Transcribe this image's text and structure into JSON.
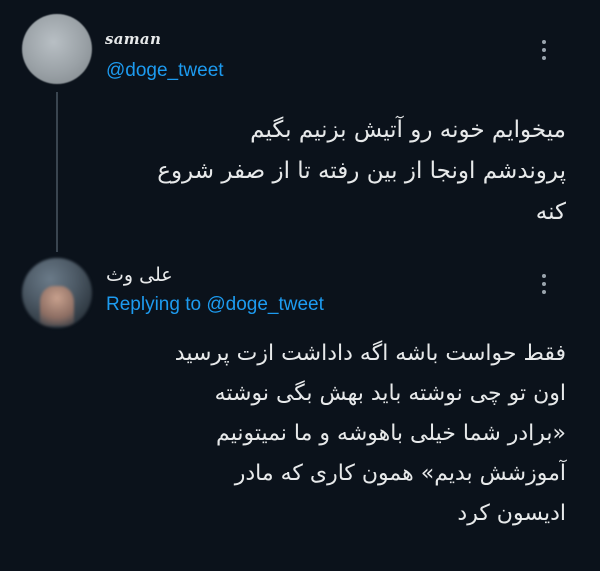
{
  "tweets": [
    {
      "author_name": "saman",
      "handle": "@doge_tweet",
      "lines": [
        "میخوایم خونه رو آتیش بزنیم بگیم",
        "پروندشم اونجا از بین رفته تا از صفر شروع",
        "کنه"
      ]
    },
    {
      "author_name": "علی وث",
      "replying_label": "Replying to",
      "replying_handle": "@doge_tweet",
      "lines": [
        "فقط حواست باشه اگه داداشت ازت پرسید",
        "اون تو چی نوشته باید بهش بگی نوشته",
        "«برادر شما خیلی باهوشه و ما نمیتونیم",
        "آموزشش بدیم» همون کاری که مادر",
        "ادیسون کرد"
      ]
    }
  ],
  "icons": {
    "more": "more-vertical-icon"
  },
  "colors": {
    "background": "#0b121b",
    "text": "#e7e9ea",
    "link": "#1d9bf0",
    "thread_line": "#3a4550"
  }
}
